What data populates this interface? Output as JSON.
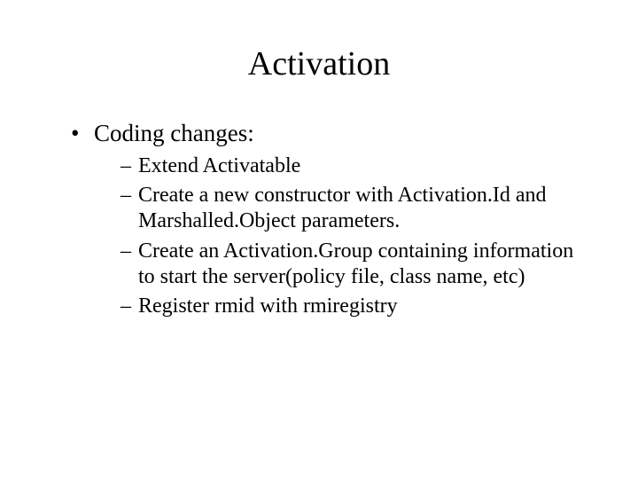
{
  "title": "Activation",
  "bullets": [
    {
      "text": "Coding changes:",
      "children": [
        "Extend Activatable",
        "Create a new constructor with Activation.Id and Marshalled.Object parameters.",
        "Create an Activation.Group containing information to start the server(policy file, class name, etc)",
        "Register rmid with rmiregistry"
      ]
    }
  ]
}
